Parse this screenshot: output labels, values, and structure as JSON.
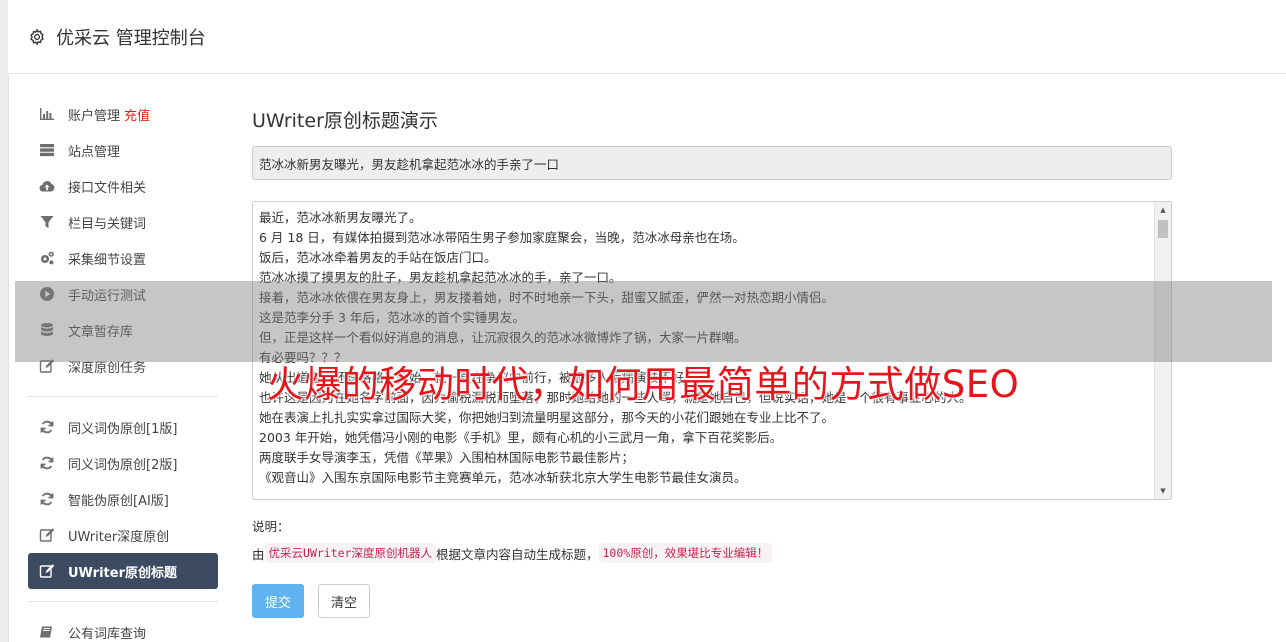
{
  "app": {
    "title": "优采云 管理控制台",
    "icon": "gear-icon"
  },
  "sidebar": {
    "group1": [
      {
        "label": "账户管理",
        "badge": "充值",
        "icon": "bar-chart-icon"
      },
      {
        "label": "站点管理",
        "icon": "server-icon"
      },
      {
        "label": "接口文件相关",
        "icon": "cloud-upload-icon"
      },
      {
        "label": "栏目与关键词",
        "icon": "filter-icon"
      },
      {
        "label": "采集细节设置",
        "icon": "cogs-icon"
      },
      {
        "label": "手动运行测试",
        "icon": "play-circle-icon"
      },
      {
        "label": "文章暂存库",
        "icon": "database-icon"
      },
      {
        "label": "深度原创任务",
        "icon": "edit-icon"
      }
    ],
    "group2": [
      {
        "label": "同义词伪原创[1版]",
        "icon": "refresh-icon"
      },
      {
        "label": "同义词伪原创[2版]",
        "icon": "refresh-icon"
      },
      {
        "label": "智能伪原创[AI版]",
        "icon": "refresh-icon"
      },
      {
        "label": "UWriter深度原创",
        "icon": "edit-icon"
      },
      {
        "label": "UWriter原创标题",
        "icon": "edit-icon",
        "active": true
      }
    ],
    "group3": [
      {
        "label": "公有词库查询",
        "icon": "book-icon"
      }
    ]
  },
  "main": {
    "title": "UWriter原创标题演示",
    "title_input_value": "范冰冰新男友曝光，男友趁机拿起范冰冰的手亲了一口",
    "content_lines": [
      "最近，范冰冰新男友曝光了。",
      "6 月 18 日，有媒体拍摄到范冰冰带陌生男子参加家庭聚会，当晚，范冰冰母亲也在场。",
      "饭后，范冰冰牵着男友的手站在饭店门口。",
      "范冰冰摸了摸男友的肚子，男友趁机拿起范冰冰的手，亲了一口。",
      "接着，范冰冰依偎在男友身上，男友搂着她，时不时地亲一下头，甜蜜又腻歪，俨然一对热恋期小情侣。",
      "这是范李分手 3 年后，范冰冰的首个实锤男友。",
      "但，正是这样一个看似好消息的消息，让沉寂很久的范冰冰微博炸了锅，大家一片群嘲。",
      "有必要吗？？？",
      "她从出道在《还珠格格》开始，就一直在争议中前行，被很多人诟病演技不好。",
      "也许这是因为在她名字前面，因为偷税漏税而堕落，那时她给她的一些人骂，就是她自己，但说实话，她是一个很有事业心的人。",
      "她在表演上扎扎实实拿过国际大奖，你把她归到流量明星这部分，那今天的小花们跟她在专业上比不了。",
      "2003 年开始，她凭借冯小刚的电影《手机》里，颇有心机的小三武月一角，拿下百花奖影后。",
      "两度联手女导演李玉，凭借《苹果》入围柏林国际电影节最佳影片；",
      "《观音山》入围东京国际电影节主竞赛单元，范冰冰斩获北京大学生电影节最佳女演员。"
    ],
    "note_label": "说明：",
    "note_prefix": "由",
    "note_code1": "优采云UWriter深度原创机器人",
    "note_middle": "根据文章内容自动生成标题，",
    "note_code2": "100%原创，效果堪比专业编辑！",
    "submit_label": "提交",
    "clear_label": "清空"
  },
  "overlay": {
    "text": "火爆的移动时代，如何用最简单的方式做SEO"
  },
  "colors": {
    "accent_active": "#3d4b62",
    "primary_button": "#5fb3f0",
    "recharge": "#d9261c",
    "overlay_text": "#e8141b"
  }
}
